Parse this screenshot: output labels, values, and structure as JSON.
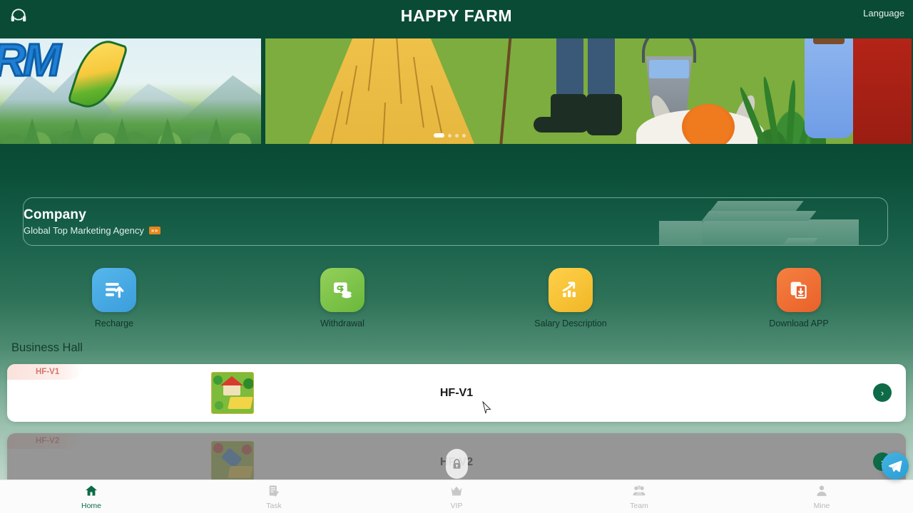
{
  "header": {
    "title": "HAPPY FARM",
    "support_icon": "headset-icon",
    "language_label": "Language"
  },
  "banner": {
    "left_logo_text": "RM",
    "carousel": {
      "total_dots": 4,
      "active_index": 0
    }
  },
  "company": {
    "title": "Company",
    "subtitle": "Global Top Marketing Agency",
    "badge": "»»"
  },
  "actions": [
    {
      "label": "Recharge",
      "icon": "recharge-icon",
      "color": "#3b9ddb"
    },
    {
      "label": "Withdrawal",
      "icon": "withdrawal-icon",
      "color": "#6ab83c"
    },
    {
      "label": "Salary Description",
      "icon": "salary-icon",
      "color": "#f0b726"
    },
    {
      "label": "Download APP",
      "icon": "download-icon",
      "color": "#e9612a"
    }
  ],
  "business_hall": {
    "title": "Business Hall",
    "cards": [
      {
        "badge": "HF-V1",
        "name": "HF-V1",
        "locked": false,
        "go_icon": "chevron-right-icon"
      },
      {
        "badge": "HF-V2",
        "name": "HF-V2",
        "locked": true,
        "go_icon": "chevron-right-icon",
        "lock_icon": "lock-icon"
      }
    ]
  },
  "float_button": {
    "icon": "telegram-icon",
    "color": "#2a9ed6"
  },
  "bottom_nav": {
    "active": "Home",
    "items": [
      {
        "label": "Home",
        "icon": "home-icon"
      },
      {
        "label": "Task",
        "icon": "task-icon"
      },
      {
        "label": "VIP",
        "icon": "crown-icon"
      },
      {
        "label": "Team",
        "icon": "team-icon"
      },
      {
        "label": "Mine",
        "icon": "person-icon"
      }
    ]
  }
}
